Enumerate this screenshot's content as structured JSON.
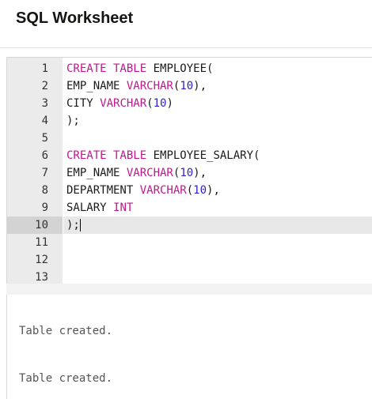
{
  "header": {
    "title": "SQL Worksheet"
  },
  "editor": {
    "lines": [
      {
        "num": "1",
        "tokens": [
          {
            "t": "CREATE TABLE",
            "c": "kw"
          },
          {
            "t": " EMPLOYEE(",
            "c": ""
          }
        ]
      },
      {
        "num": "2",
        "tokens": [
          {
            "t": "EMP_NAME ",
            "c": ""
          },
          {
            "t": "VARCHAR",
            "c": "kw"
          },
          {
            "t": "(",
            "c": ""
          },
          {
            "t": "10",
            "c": "num-lit"
          },
          {
            "t": "),",
            "c": ""
          }
        ]
      },
      {
        "num": "3",
        "tokens": [
          {
            "t": "CITY ",
            "c": ""
          },
          {
            "t": "VARCHAR",
            "c": "kw"
          },
          {
            "t": "(",
            "c": ""
          },
          {
            "t": "10",
            "c": "num-lit"
          },
          {
            "t": ")",
            "c": ""
          }
        ]
      },
      {
        "num": "4",
        "tokens": [
          {
            "t": ");",
            "c": ""
          }
        ]
      },
      {
        "num": "5",
        "tokens": []
      },
      {
        "num": "6",
        "tokens": [
          {
            "t": "CREATE TABLE",
            "c": "kw"
          },
          {
            "t": " EMPLOYEE_SALARY(",
            "c": ""
          }
        ]
      },
      {
        "num": "7",
        "tokens": [
          {
            "t": "EMP_NAME ",
            "c": ""
          },
          {
            "t": "VARCHAR",
            "c": "kw"
          },
          {
            "t": "(",
            "c": ""
          },
          {
            "t": "10",
            "c": "num-lit"
          },
          {
            "t": "),",
            "c": ""
          }
        ]
      },
      {
        "num": "8",
        "tokens": [
          {
            "t": "DEPARTMENT ",
            "c": ""
          },
          {
            "t": "VARCHAR",
            "c": "kw"
          },
          {
            "t": "(",
            "c": ""
          },
          {
            "t": "10",
            "c": "num-lit"
          },
          {
            "t": "),",
            "c": ""
          }
        ]
      },
      {
        "num": "9",
        "tokens": [
          {
            "t": "SALARY ",
            "c": ""
          },
          {
            "t": "INT",
            "c": "kw"
          }
        ]
      },
      {
        "num": "10",
        "tokens": [
          {
            "t": ");",
            "c": ""
          }
        ],
        "active": true
      },
      {
        "num": "11",
        "tokens": []
      },
      {
        "num": "12",
        "tokens": []
      },
      {
        "num": "13",
        "tokens": []
      }
    ]
  },
  "output": {
    "messages": [
      "Table created.",
      "Table created."
    ]
  },
  "colors": {
    "keyword": "#c3168f",
    "number": "#2c1fd3",
    "gutter": "#ebebeb",
    "active_line": "#e8e8e8"
  }
}
